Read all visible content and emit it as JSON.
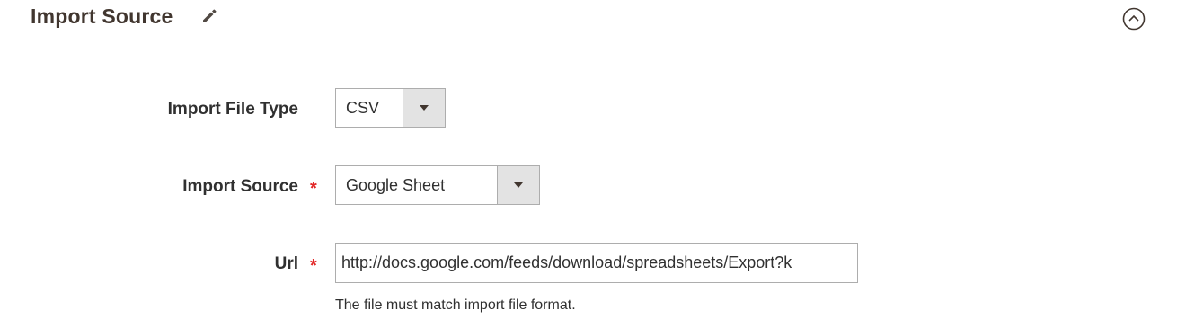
{
  "section": {
    "title": "Import Source",
    "edit_icon": "pencil-icon",
    "collapse_icon": "chevron-up-circle-icon"
  },
  "fields": {
    "file_type": {
      "label": "Import File Type",
      "value": "CSV"
    },
    "import_source": {
      "label": "Import Source",
      "required": "*",
      "value": "Google Sheet"
    },
    "url": {
      "label": "Url",
      "required": "*",
      "value": "http://docs.google.com/feeds/download/spreadsheets/Export?k",
      "note": "The file must match import file format."
    }
  },
  "colors": {
    "required": "#e22626",
    "title": "#41362f",
    "border": "#adadad",
    "arrow_bg": "#e3e3e3"
  }
}
